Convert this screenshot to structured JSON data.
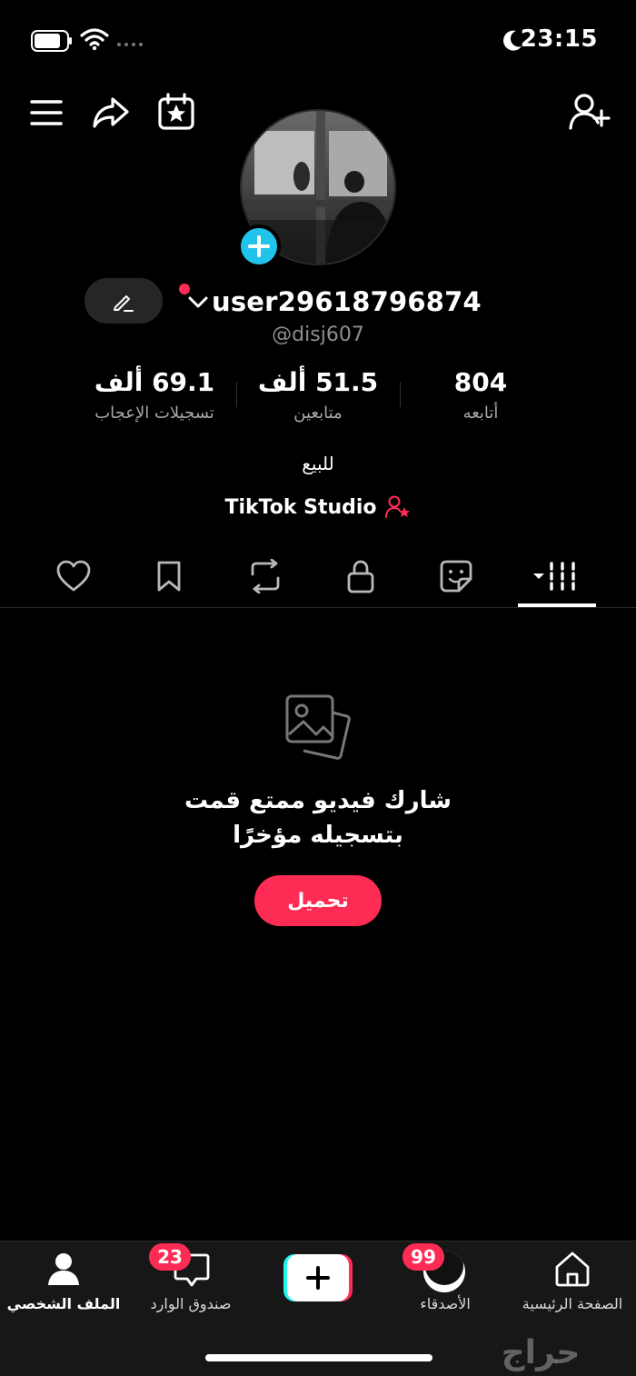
{
  "status_bar": {
    "time": "23:15"
  },
  "header": {
    "icons": [
      "menu-icon",
      "share-icon",
      "calendar-star-icon",
      "add-friend-icon"
    ]
  },
  "profile": {
    "display_name": "user29618796874",
    "handle": "@disj607",
    "bio": "للبيع",
    "studio_label": "TikTok Studio"
  },
  "stats": {
    "likes": {
      "value": "69.1 ألف",
      "label": "تسجيلات الإعجاب"
    },
    "followers": {
      "value": "51.5 ألف",
      "label": "متابعين"
    },
    "following": {
      "value": "804",
      "label": "أتابعه"
    }
  },
  "tabs": [
    "liked-tab",
    "saved-tab",
    "reposts-tab",
    "private-tab",
    "stickers-tab",
    "videos-tab"
  ],
  "empty_state": {
    "line1": "شارك فيديو ممتع قمت",
    "line2": "بتسجيله مؤخرًا",
    "upload_button": "تحميل"
  },
  "bottom_nav": {
    "profile": "الملف الشخصي",
    "inbox": "صندوق الوارد",
    "inbox_badge": "23",
    "friends": "الأصدقاء",
    "friends_badge": "99",
    "home": "الصفحة الرئيسية"
  },
  "watermark": "حراج",
  "colors": {
    "accent": "#fe2c55",
    "add_badge": "#20c4eb",
    "background": "#000000"
  }
}
